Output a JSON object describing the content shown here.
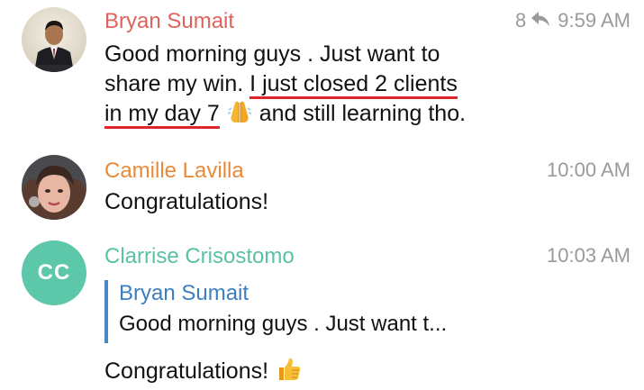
{
  "messages": [
    {
      "sender": "Bryan Sumait",
      "sender_color": "#e0625c",
      "views": "8",
      "time": "9:59 AM",
      "line1": "Good morning guys . Just want to",
      "line2_plain": "share my win. ",
      "line2_highlight": "I just closed 2 clients",
      "line3_highlight": "in my day 7",
      "line3_rest": "and still learning tho.",
      "emoji": "🙏"
    },
    {
      "sender": "Camille Lavilla",
      "sender_color": "#e88a3a",
      "time": "10:00 AM",
      "text": "Congratulations!"
    },
    {
      "sender": "Clarrise Crisostomo",
      "sender_color": "#59c2a4",
      "avatar_initials": "CC",
      "time": "10:03 AM",
      "reply_to": {
        "sender": "Bryan Sumait",
        "text": "Good morning guys . Just want t..."
      },
      "text": "Congratulations!",
      "emoji": "👍"
    }
  ],
  "icons": {
    "forward": "forward-arrow-icon",
    "pray": "folded-hands-emoji",
    "thumbs": "thumbs-up-emoji"
  }
}
